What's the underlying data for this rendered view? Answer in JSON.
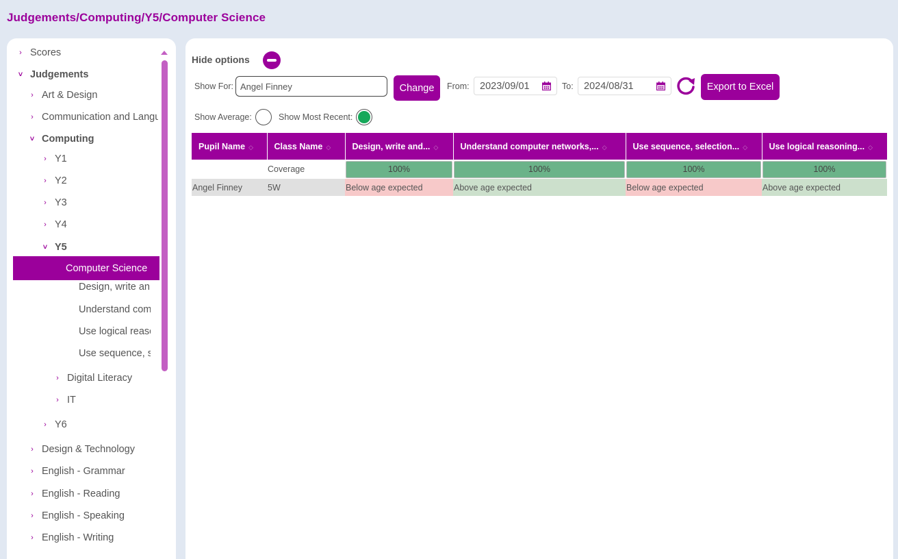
{
  "breadcrumb": "Judgements/Computing/Y5/Computer Science",
  "sidebar": {
    "items": [
      {
        "label": "Scores",
        "level": 0,
        "expanded": false
      },
      {
        "label": "Judgements",
        "level": 0,
        "expanded": true
      },
      {
        "label": "Art & Design",
        "level": 1,
        "expanded": false
      },
      {
        "label": "Communication and Langu",
        "level": 1,
        "expanded": false
      },
      {
        "label": "Computing",
        "level": 1,
        "expanded": true
      },
      {
        "label": "Y1",
        "level": 2,
        "expanded": false
      },
      {
        "label": "Y2",
        "level": 2,
        "expanded": false
      },
      {
        "label": "Y3",
        "level": 2,
        "expanded": false
      },
      {
        "label": "Y4",
        "level": 2,
        "expanded": false
      },
      {
        "label": "Y5",
        "level": 2,
        "expanded": true
      },
      {
        "label": "Digital Literacy",
        "level": 3,
        "expanded": false
      },
      {
        "label": "IT",
        "level": 3,
        "expanded": false
      },
      {
        "label": "Y6",
        "level": 2,
        "expanded": false
      },
      {
        "label": "Design & Technology",
        "level": 1,
        "expanded": false
      },
      {
        "label": "English - Grammar",
        "level": 1,
        "expanded": false
      },
      {
        "label": "English - Reading",
        "level": 1,
        "expanded": false
      },
      {
        "label": "English - Speaking",
        "level": 1,
        "expanded": false
      },
      {
        "label": "English - Writing",
        "level": 1,
        "expanded": false
      }
    ],
    "selected": "Computer Science",
    "leaves": [
      "Design, write an",
      "Understand com",
      "Use logical reasc",
      "Use sequence, s"
    ]
  },
  "options": {
    "hide_label": "Hide options",
    "show_for_label": "Show For:",
    "show_for_value": "Angel Finney",
    "change_label": "Change",
    "from_label": "From:",
    "from_value": "2023/09/01",
    "to_label": "To:",
    "to_value": "2024/08/31",
    "export_label": "Export to Excel",
    "show_average_label": "Show Average:",
    "show_average": false,
    "show_most_recent_label": "Show Most Recent:",
    "show_most_recent": true
  },
  "table": {
    "headers": [
      "Pupil Name",
      "Class Name",
      "Design, write and...",
      "Understand computer networks,...",
      "Use sequence, selection...",
      "Use logical reasoning..."
    ],
    "coverage_label": "Coverage",
    "coverage": [
      "100%",
      "100%",
      "100%",
      "100%"
    ],
    "rows": [
      {
        "pupil": "Angel Finney",
        "class": "5W",
        "values": [
          "Below age expected",
          "Above age expected",
          "Below age expected",
          "Above age expected"
        ]
      }
    ]
  },
  "colors": {
    "accent": "#9b009b",
    "coverage_green": "#6bb389",
    "below": "#f7c9c9",
    "above": "#cce0cc",
    "toggle_on": "#16a85a"
  }
}
